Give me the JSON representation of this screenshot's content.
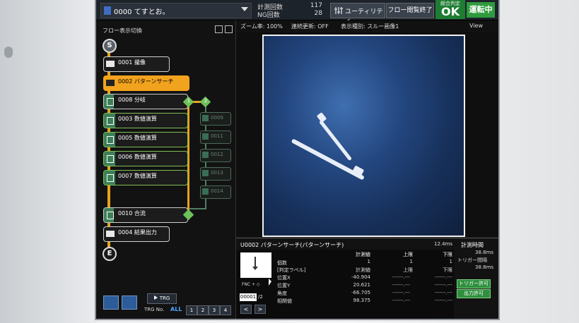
{
  "header": {
    "flow_selector": "0000 てすとお。",
    "measure_count_label": "計測回数",
    "measure_count_value": "117",
    "ng_count_label": "NG回数",
    "ng_count_value": "28",
    "utility_label": "ユーティリティ",
    "flow_edit_end_label": "フロー閲覧終了",
    "total_judge_label": "総合判定",
    "total_judge_value": "OK",
    "running_label": "運転中"
  },
  "flow_panel": {
    "title": "フロー表示切換",
    "start": "S",
    "end": "E",
    "nodes": [
      {
        "label": "0001 撮像"
      },
      {
        "label": "0002 パターンサーチ"
      },
      {
        "label": "0008 分岐"
      },
      {
        "label": "0003 数値演算"
      },
      {
        "label": "0005 数値演算"
      },
      {
        "label": "0006 数値演算"
      },
      {
        "label": "0007 数値演算"
      },
      {
        "label": "0010 合流"
      },
      {
        "label": "0004 結果出力"
      }
    ],
    "branch_numbers": [
      "1",
      "2"
    ],
    "ghost_nodes": [
      "0009",
      "0011",
      "0012",
      "0013",
      "0014"
    ],
    "trg_button": "TRG",
    "trg_no_label": "TRG No.",
    "trg_all": "ALL",
    "trg_tabs": [
      "1",
      "2",
      "3",
      "4"
    ]
  },
  "view": {
    "zoom": "ズーム率: 100%",
    "continuous_update": "連続更新: OFF",
    "display_type": "表示種別: スルー画像1",
    "view_label": "View"
  },
  "result": {
    "title": "U0002 パターンサーチ(パターンサーチ)",
    "time": "12.4ms",
    "fnc_label": "FNC + ◇",
    "page": "00001",
    "page_total": "/2",
    "headers": {
      "measured": "計測値",
      "upper": "上限",
      "lower": "下限"
    },
    "rows": [
      {
        "label": "個数",
        "value": "1",
        "upper": "1",
        "lower": "1"
      },
      {
        "label": "[判定ラベル]",
        "value": "計測値",
        "upper": "上限",
        "lower": "下限"
      },
      {
        "label": "位置X",
        "value": "-40.904",
        "upper": "------.---",
        "lower": "------.---"
      },
      {
        "label": "位置Y",
        "value": "20.621",
        "upper": "------.---",
        "lower": "------.---"
      },
      {
        "label": "角度",
        "value": "-66.705",
        "upper": "------.---",
        "lower": "------.---"
      },
      {
        "label": "相関値",
        "value": "98.375",
        "upper": "------.---",
        "lower": "------.---"
      }
    ]
  },
  "side": {
    "measure_time_label": "計測時間",
    "measure_time_value": "38.8ms",
    "trigger_interval_label": "トリガー間隔",
    "trigger_interval_value": "38.8ms",
    "trigger_permit": "トリガー許可",
    "output_permit": "出力許可"
  }
}
